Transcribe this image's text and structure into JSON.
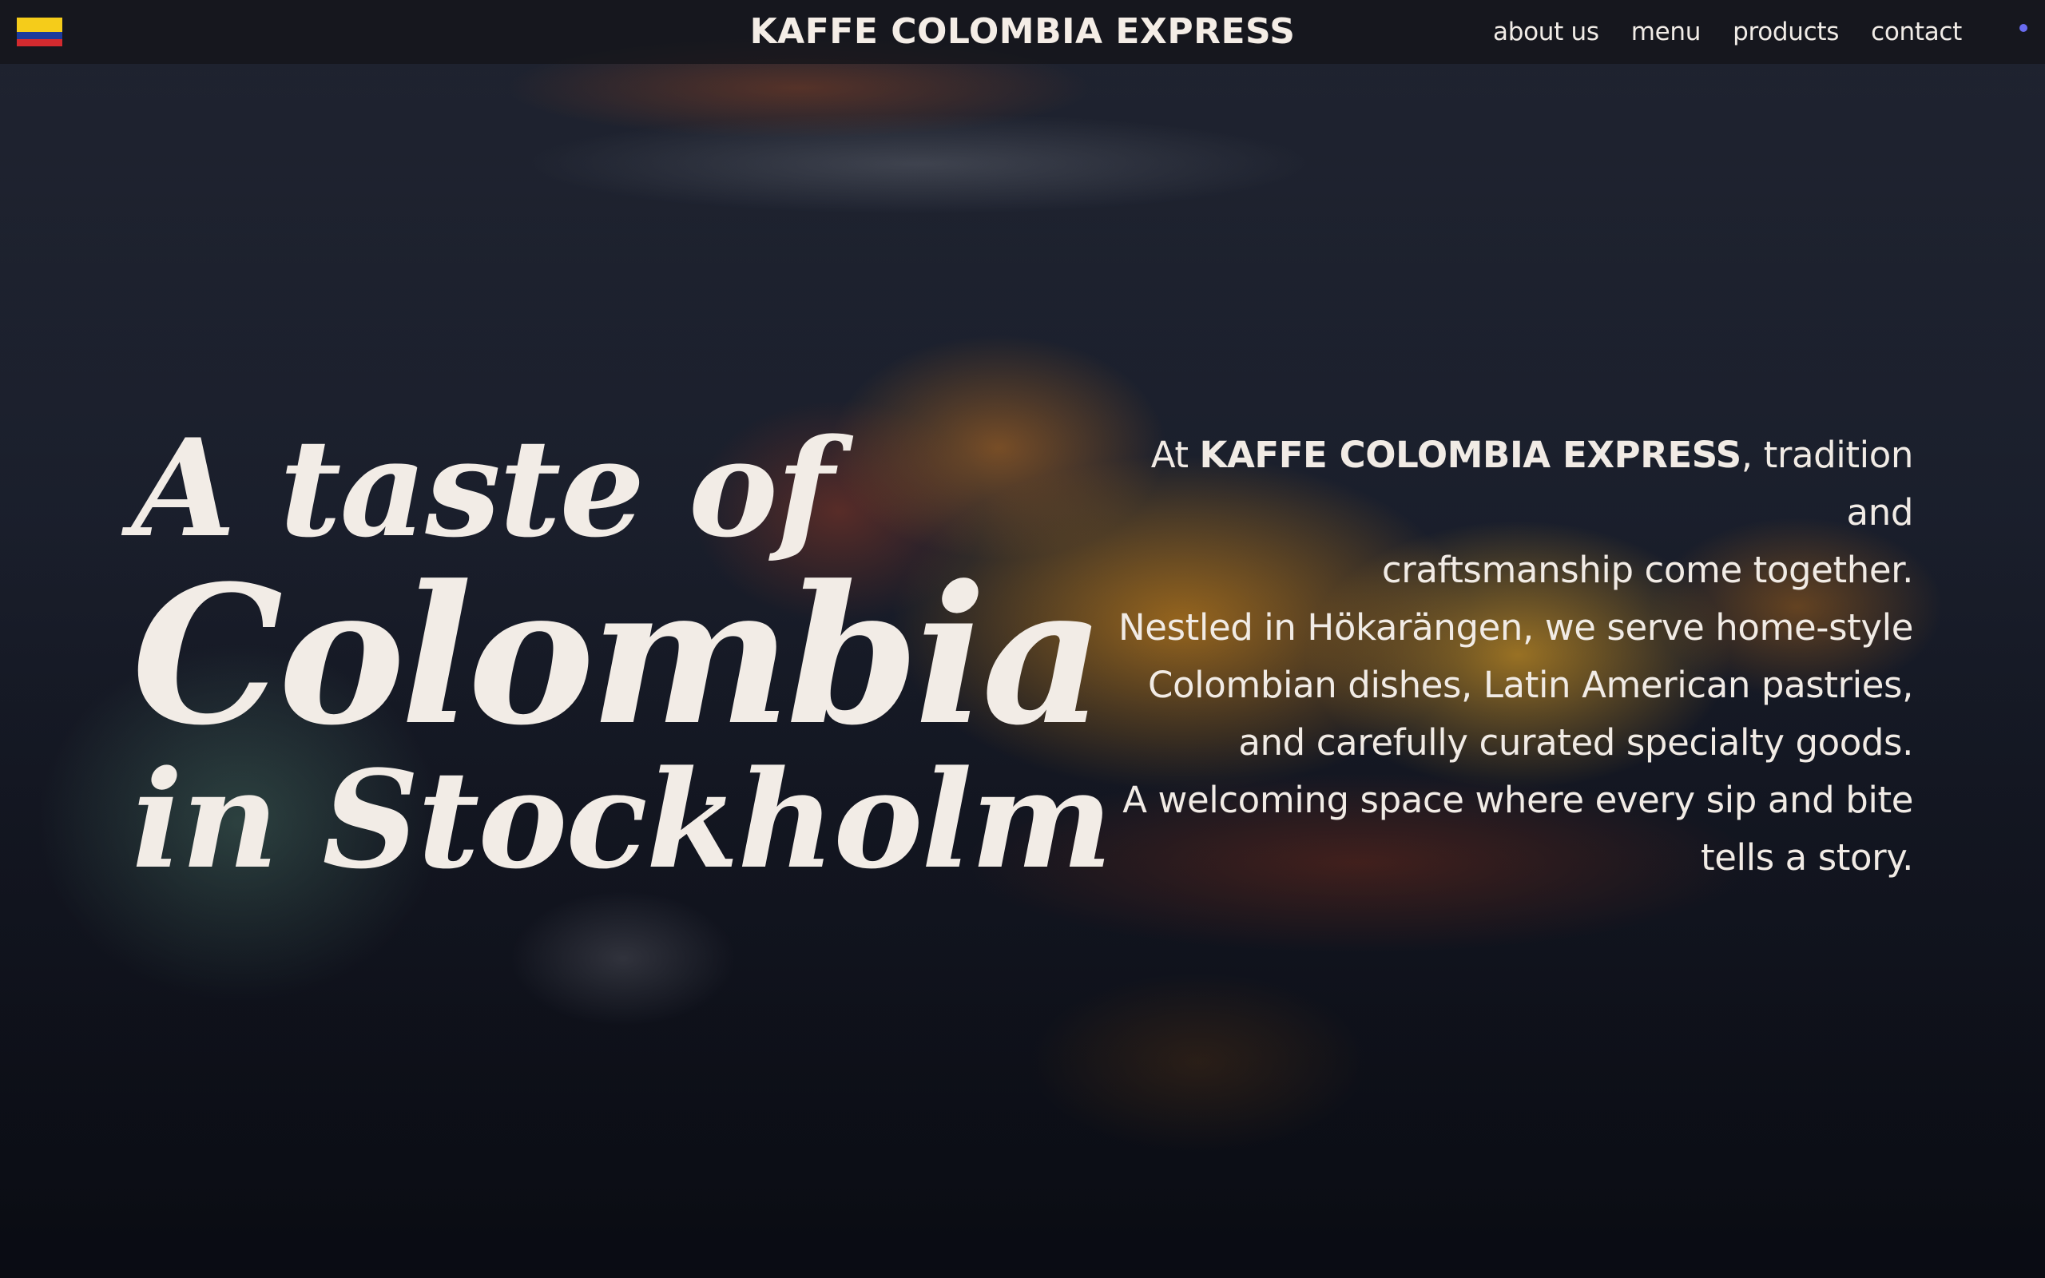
{
  "header": {
    "brand": "KAFFE COLOMBIA EXPRESS",
    "flag_icon": "colombia-flag-icon",
    "nav": [
      "about us",
      "menu",
      "products",
      "contact"
    ],
    "theme_toggle_icon": "moon-icon"
  },
  "hero": {
    "headline_line1": "A taste of",
    "headline_line2": "Colombia",
    "headline_line3": "in Stockholm",
    "intro_prefix": "At ",
    "intro_brand": "KAFFE COLOMBIA EXPRESS",
    "intro_line1_suffix": ", tradition and",
    "intro_line2": "craftsmanship come together.",
    "intro_line3": "Nestled in Hökarängen, we serve home-style",
    "intro_line4": "Colombian dishes, Latin American pastries,",
    "intro_line5": "and carefully curated specialty goods.",
    "intro_line6": "A welcoming space where every sip and bite",
    "intro_line7": "tells a story."
  },
  "colors": {
    "text": "#f2ece6",
    "flag_yellow": "#f5cc1a",
    "flag_blue": "#1c3a9c",
    "flag_red": "#d32a2f",
    "accent_dot": "#6a6cf0"
  }
}
